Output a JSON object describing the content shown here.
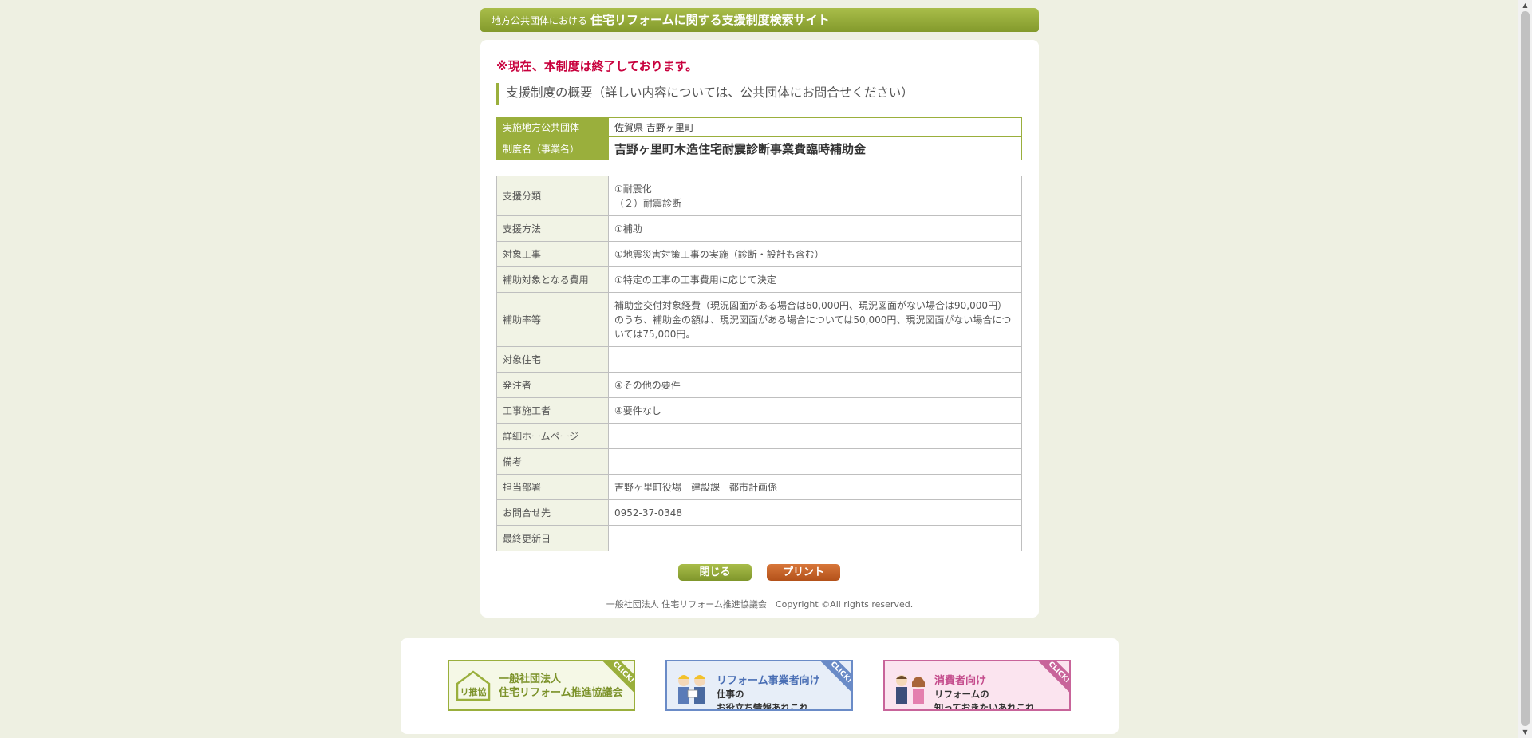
{
  "header": {
    "small": "地方公共団体における",
    "title": "住宅リフォームに関する支援制度検索サイト"
  },
  "notice": "※現在、本制度は終了しております。",
  "section_title": "支援制度の概要（詳しい内容については、公共団体にお問合せください）",
  "summary": {
    "municipality_label": "実施地方公共団体",
    "municipality_value": "佐賀県 吉野ヶ里町",
    "program_label": "制度名（事業名）",
    "program_value": "吉野ヶ里町木造住宅耐震診断事業費臨時補助金"
  },
  "details": [
    {
      "label": "支援分類",
      "lines": [
        "①耐震化",
        "（２）耐震診断"
      ]
    },
    {
      "label": "支援方法",
      "lines": [
        "①補助"
      ]
    },
    {
      "label": "対象工事",
      "lines": [
        "①地震災害対策工事の実施（診断・設計も含む）"
      ]
    },
    {
      "label": "補助対象となる費用",
      "lines": [
        "①特定の工事の工事費用に応じて決定"
      ]
    },
    {
      "label": "補助率等",
      "lines": [
        "補助金交付対象経費（現況図面がある場合は60,000円、現況図面がない場合は90,000円）のうち、補助金の額は、現況図面がある場合については50,000円、現況図面がない場合については75,000円。"
      ]
    },
    {
      "label": "対象住宅",
      "lines": [
        ""
      ]
    },
    {
      "label": "発注者",
      "lines": [
        "④その他の要件"
      ]
    },
    {
      "label": "工事施工者",
      "lines": [
        "④要件なし"
      ]
    },
    {
      "label": "詳細ホームページ",
      "lines": [
        ""
      ]
    },
    {
      "label": "備考",
      "lines": [
        ""
      ]
    },
    {
      "label": "担当部署",
      "lines": [
        "吉野ヶ里町役場　建設課　都市計画係"
      ]
    },
    {
      "label": "お問合せ先",
      "lines": [
        "0952-37-0348"
      ]
    },
    {
      "label": "最終更新日",
      "lines": [
        ""
      ]
    }
  ],
  "buttons": {
    "close": "閉じる",
    "print": "プリント"
  },
  "copyright": "一般社団法人 住宅リフォーム推進協議会　Copyright ©All rights reserved.",
  "banners": [
    {
      "title": "一般社団法人",
      "line2": "住宅リフォーム推進協議会",
      "line3": "",
      "click": "CLICK!"
    },
    {
      "title": "リフォーム事業者向け",
      "line2": "仕事の",
      "line3": "お役立ち情報あれこれ",
      "click": "CLICK!"
    },
    {
      "title": "消費者向け",
      "line2": "リフォームの",
      "line3": "知っておきたいあれこれ",
      "click": "CLICK!"
    }
  ],
  "logo_text": "リ推協",
  "colors": {
    "accent": "#9aaf3c",
    "notice": "#c8003d",
    "print": "#c4621f"
  }
}
